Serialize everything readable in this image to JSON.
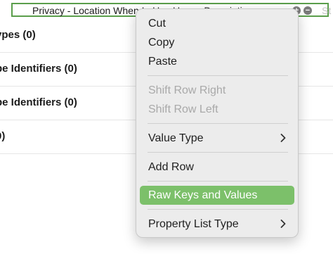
{
  "editor": {
    "editing_key": "Privacy - Location When In Use Usage Description",
    "type_hint": "St",
    "rows": [
      {
        "label": "ypes (0)"
      },
      {
        "label": "pe Identifiers (0)"
      },
      {
        "label": "pe Identifiers (0)"
      },
      {
        "label": "0)"
      }
    ]
  },
  "context_menu": {
    "items": [
      {
        "label": "Cut",
        "enabled": true
      },
      {
        "label": "Copy",
        "enabled": true
      },
      {
        "label": "Paste",
        "enabled": true
      },
      {
        "label": "Shift Row Right",
        "enabled": false
      },
      {
        "label": "Shift Row Left",
        "enabled": false
      },
      {
        "label": "Value Type",
        "enabled": true,
        "submenu": true
      },
      {
        "label": "Add Row",
        "enabled": true
      },
      {
        "label": "Raw Keys and Values",
        "enabled": true,
        "highlighted": true
      },
      {
        "label": "Property List Type",
        "enabled": true,
        "submenu": true
      }
    ],
    "highlight_color": "#7cc06a",
    "icons": {
      "submenu": "chevron-right-icon"
    }
  }
}
